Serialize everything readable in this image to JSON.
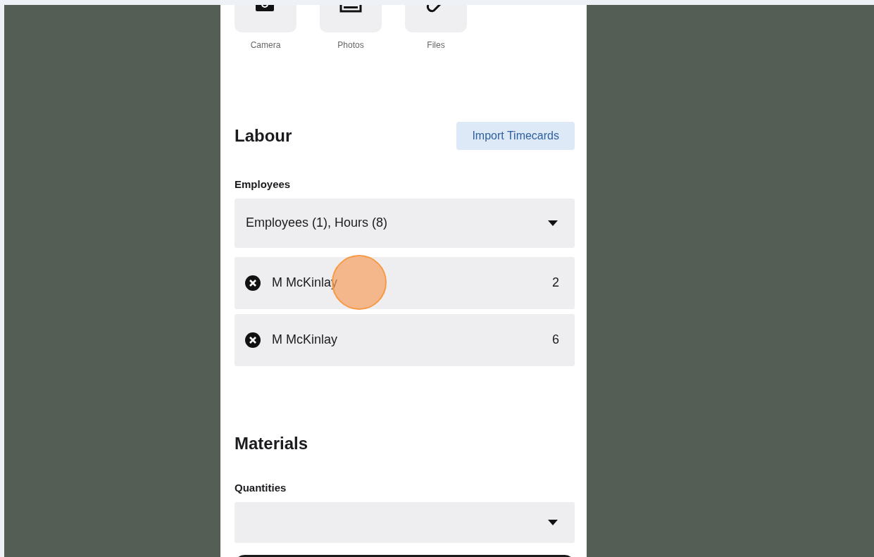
{
  "attachments": [
    {
      "kind": "camera",
      "label": "Camera"
    },
    {
      "kind": "photos",
      "label": "Photos"
    },
    {
      "kind": "files",
      "label": "Files"
    }
  ],
  "labour": {
    "title": "Labour",
    "import_button": "Import Timecards",
    "field_label": "Employees",
    "dropdown_value": "Employees (1), Hours (8)",
    "entries": [
      {
        "name": "M McKinlay",
        "hours": "2"
      },
      {
        "name": "M McKinlay",
        "hours": "6"
      }
    ]
  },
  "materials": {
    "title": "Materials",
    "field_label": "Quantities"
  }
}
